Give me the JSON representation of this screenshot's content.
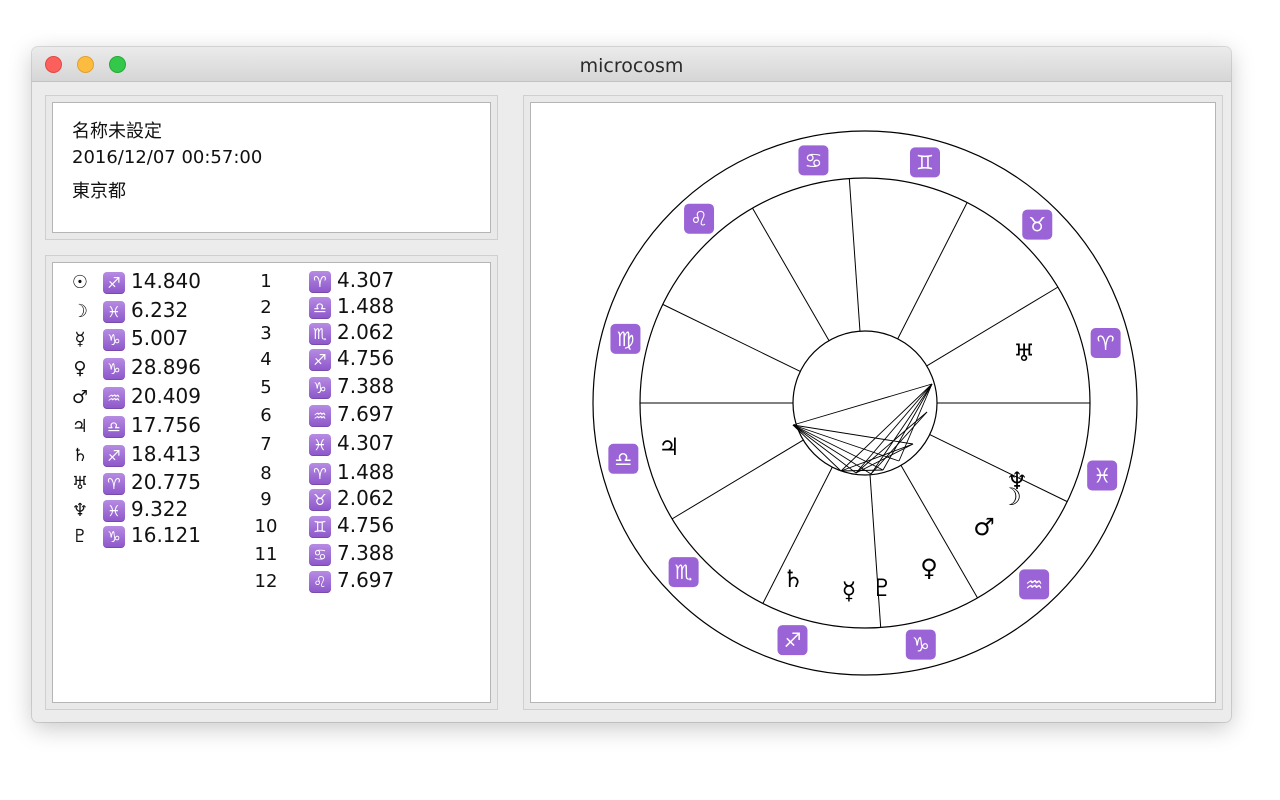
{
  "window": {
    "title": "microcosm"
  },
  "info": {
    "name": "名称未設定",
    "datetime": "2016/12/07 00:57:00",
    "place": "東京都"
  },
  "planets": [
    {
      "planet": "Sun",
      "glyph": "☉",
      "sign_glyph": "♐",
      "degree": "14.840"
    },
    {
      "planet": "Moon",
      "glyph": "☽",
      "sign_glyph": "♓",
      "degree": "6.232"
    },
    {
      "planet": "Mercury",
      "glyph": "☿",
      "sign_glyph": "♑",
      "degree": "5.007"
    },
    {
      "planet": "Venus",
      "glyph": "♀",
      "sign_glyph": "♑",
      "degree": "28.896"
    },
    {
      "planet": "Mars",
      "glyph": "♂",
      "sign_glyph": "♒",
      "degree": "20.409"
    },
    {
      "planet": "Jupiter",
      "glyph": "♃",
      "sign_glyph": "♎",
      "degree": "17.756"
    },
    {
      "planet": "Saturn",
      "glyph": "♄",
      "sign_glyph": "♐",
      "degree": "18.413"
    },
    {
      "planet": "Uranus",
      "glyph": "♅",
      "sign_glyph": "♈",
      "degree": "20.775"
    },
    {
      "planet": "Neptune",
      "glyph": "♆",
      "sign_glyph": "♓",
      "degree": "9.322"
    },
    {
      "planet": "Pluto",
      "glyph": "♇",
      "sign_glyph": "♑",
      "degree": "16.121"
    }
  ],
  "houses": [
    {
      "num": "1",
      "sign_glyph": "♈",
      "degree": "4.307"
    },
    {
      "num": "2",
      "sign_glyph": "♎",
      "degree": "1.488"
    },
    {
      "num": "3",
      "sign_glyph": "♏",
      "degree": "2.062"
    },
    {
      "num": "4",
      "sign_glyph": "♐",
      "degree": "4.756"
    },
    {
      "num": "5",
      "sign_glyph": "♑",
      "degree": "7.388"
    },
    {
      "num": "6",
      "sign_glyph": "♒",
      "degree": "7.697"
    },
    {
      "num": "7",
      "sign_glyph": "♓",
      "degree": "4.307"
    },
    {
      "num": "8",
      "sign_glyph": "♈",
      "degree": "1.488"
    },
    {
      "num": "9",
      "sign_glyph": "♉",
      "degree": "2.062"
    },
    {
      "num": "10",
      "sign_glyph": "♊",
      "degree": "4.756"
    },
    {
      "num": "11",
      "sign_glyph": "♋",
      "degree": "7.388"
    },
    {
      "num": "12",
      "sign_glyph": "♌",
      "degree": "7.697"
    }
  ],
  "wheel": {
    "zodiac_ring": [
      {
        "sign": "Gemini",
        "glyph": "♊"
      },
      {
        "sign": "Taurus",
        "glyph": "♉"
      },
      {
        "sign": "Aries",
        "glyph": "♈"
      },
      {
        "sign": "Pisces",
        "glyph": "♓"
      },
      {
        "sign": "Aquarius",
        "glyph": "♒"
      },
      {
        "sign": "Capricorn",
        "glyph": "♑"
      },
      {
        "sign": "Sagittarius",
        "glyph": "♐"
      },
      {
        "sign": "Scorpio",
        "glyph": "♏"
      },
      {
        "sign": "Libra",
        "glyph": "♎"
      },
      {
        "sign": "Virgo",
        "glyph": "♍"
      },
      {
        "sign": "Leo",
        "glyph": "♌"
      },
      {
        "sign": "Cancer",
        "glyph": "♋"
      }
    ],
    "chart_planets": [
      {
        "planet": "Uranus",
        "glyph": "♅"
      },
      {
        "planet": "Jupiter",
        "glyph": "♃"
      },
      {
        "planet": "Neptune",
        "glyph": "♆"
      },
      {
        "planet": "Moon",
        "glyph": "☽"
      },
      {
        "planet": "Mars",
        "glyph": "♂"
      },
      {
        "planet": "Venus",
        "glyph": "♀"
      },
      {
        "planet": "Pluto",
        "glyph": "♇"
      },
      {
        "planet": "Mercury",
        "glyph": "☿"
      },
      {
        "planet": "Saturn",
        "glyph": "♄"
      }
    ],
    "badge_color": "#9b64d6"
  }
}
